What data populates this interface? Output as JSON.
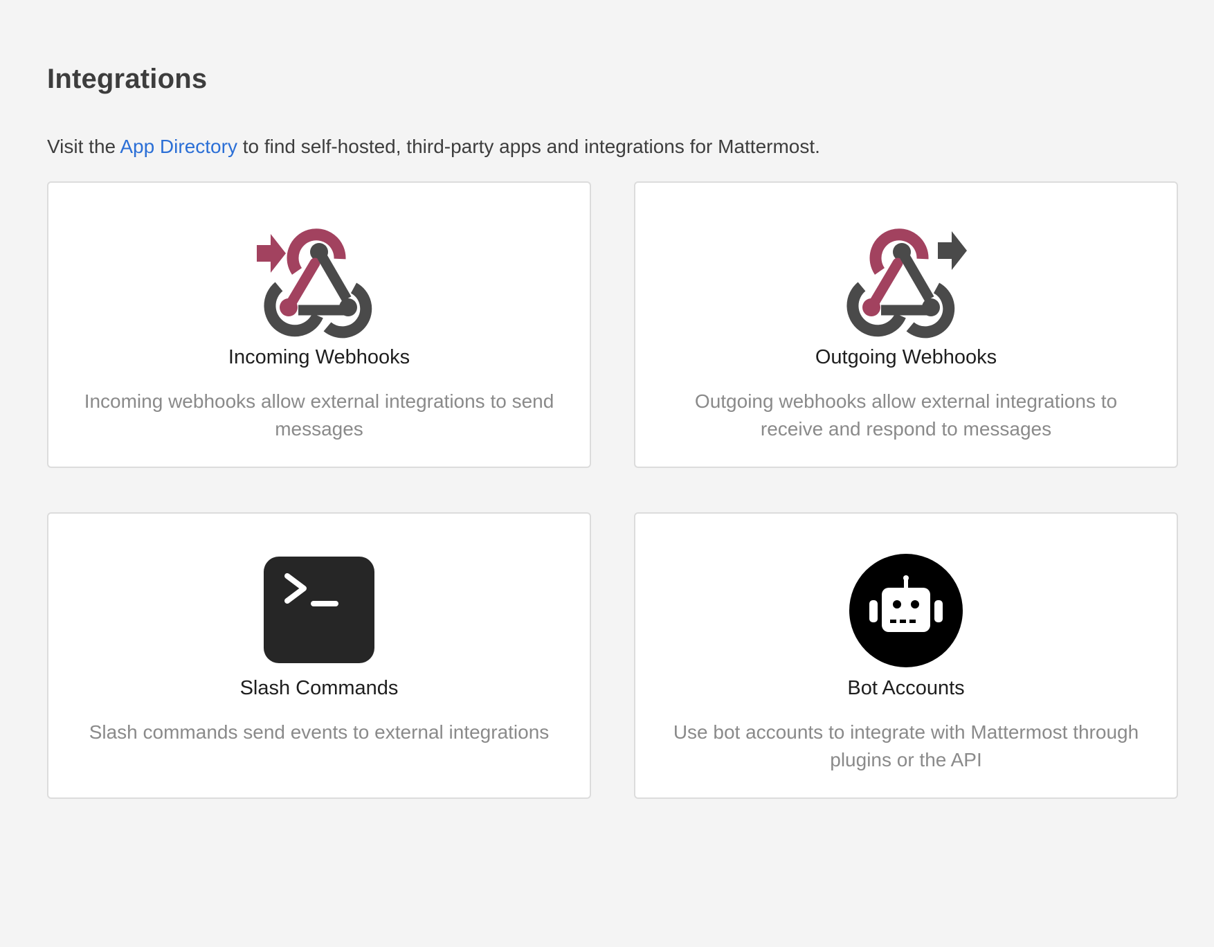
{
  "header": {
    "title": "Integrations"
  },
  "intro": {
    "prefix": "Visit the ",
    "link": "App Directory",
    "suffix": " to find self-hosted, third-party apps and integrations for Mattermost."
  },
  "colors": {
    "background": "#f4f4f4",
    "link": "#2b6fd6",
    "webhook_accent": "#a2425f",
    "webhook_dark": "#4a4a4a",
    "terminal_bg": "#262626"
  },
  "cards": [
    {
      "title": "Incoming Webhooks",
      "description": "Incoming webhooks allow external integrations to send messages",
      "icon": "incoming-webhook-icon"
    },
    {
      "title": "Outgoing Webhooks",
      "description": "Outgoing webhooks allow external integrations to receive and respond to messages",
      "icon": "outgoing-webhook-icon"
    },
    {
      "title": "Slash Commands",
      "description": "Slash commands send events to external integrations",
      "icon": "terminal-icon"
    },
    {
      "title": "Bot Accounts",
      "description": "Use bot accounts to integrate with Mattermost through plugins or the API",
      "icon": "robot-icon"
    }
  ]
}
